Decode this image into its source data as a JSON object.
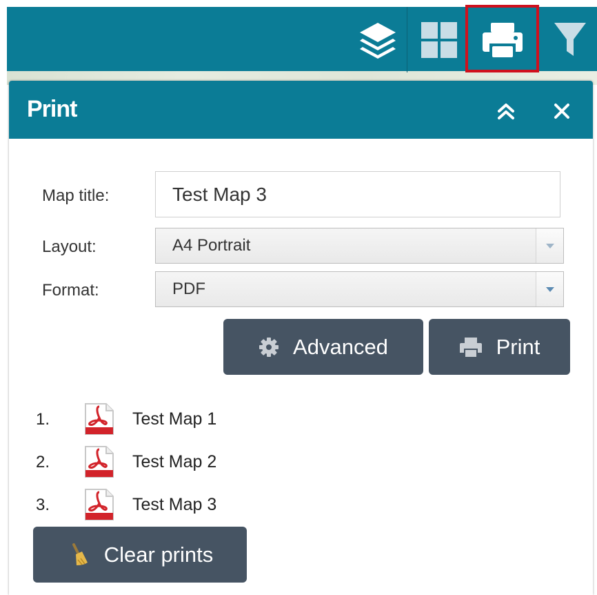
{
  "toolbar": {
    "tools": [
      {
        "name": "layers",
        "icon": "layers-icon"
      },
      {
        "name": "basemap-gallery",
        "icon": "grid-icon"
      },
      {
        "name": "print",
        "icon": "printer-icon",
        "highlighted": true
      },
      {
        "name": "filter",
        "icon": "filter-icon"
      }
    ],
    "highlight_color": "#d0101d"
  },
  "panel": {
    "title": "Print",
    "collapse_icon": "chevron-double-up-icon",
    "close_icon": "close-icon"
  },
  "form": {
    "map_title_label": "Map title:",
    "map_title_value": "Test Map 3",
    "layout_label": "Layout:",
    "layout_value": "A4 Portrait",
    "format_label": "Format:",
    "format_value": "PDF",
    "advanced_label": "Advanced",
    "print_label": "Print"
  },
  "prints": [
    {
      "num": "1.",
      "name": "Test Map 1",
      "icon": "pdf-icon"
    },
    {
      "num": "2.",
      "name": "Test Map 2",
      "icon": "pdf-icon"
    },
    {
      "num": "3.",
      "name": "Test Map 3",
      "icon": "pdf-icon"
    }
  ],
  "clear_label": "Clear prints",
  "colors": {
    "header": "#0b7c96",
    "button": "#465463",
    "pdf_red": "#d2232a"
  }
}
